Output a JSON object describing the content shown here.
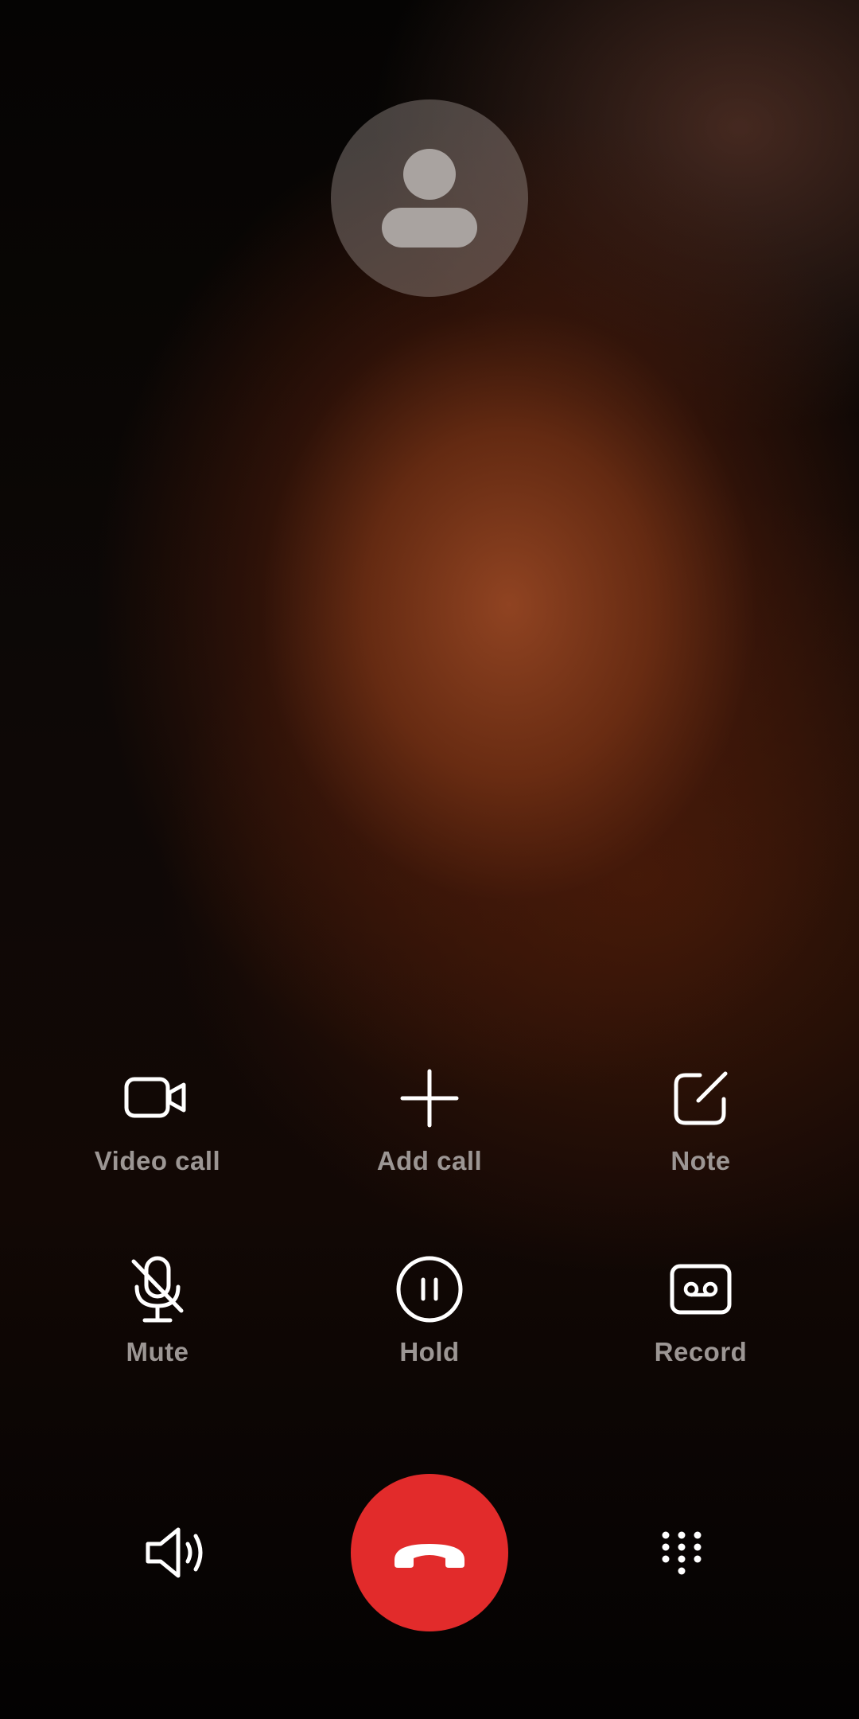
{
  "caller": {
    "avatar_icon": "person-icon"
  },
  "actions_row1": [
    {
      "label": "Video call",
      "icon": "video-camera-icon"
    },
    {
      "label": "Add call",
      "icon": "plus-icon"
    },
    {
      "label": "Note",
      "icon": "note-edit-icon"
    }
  ],
  "actions_row2": [
    {
      "label": "Mute",
      "icon": "mic-off-icon"
    },
    {
      "label": "Hold",
      "icon": "pause-circle-icon"
    },
    {
      "label": "Record",
      "icon": "voicemail-record-icon"
    }
  ],
  "bottom_bar": {
    "speaker_icon": "speaker-icon",
    "end_call_icon": "phone-hangup-icon",
    "keypad_icon": "dialpad-icon"
  },
  "colors": {
    "end_call": "#e22b2b",
    "label": "#9c9694",
    "icon": "#ffffff"
  }
}
